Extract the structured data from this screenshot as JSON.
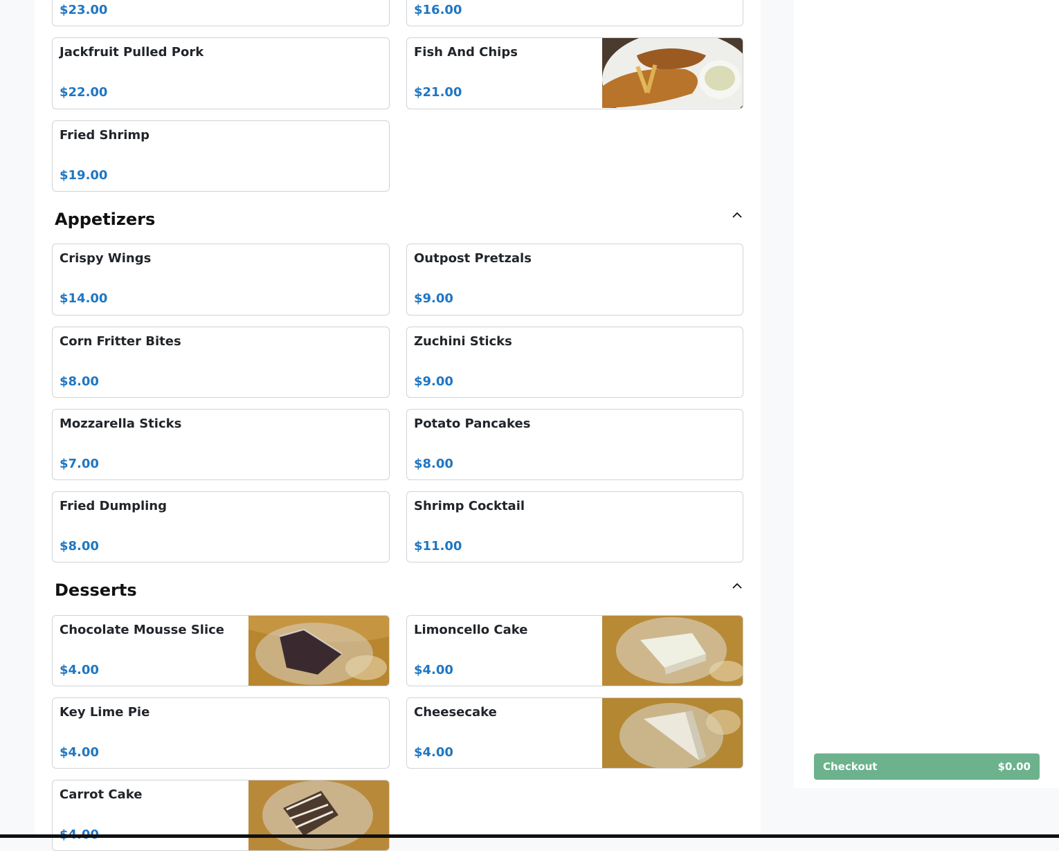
{
  "top_prices": {
    "left": "$23.00",
    "right": "$16.00"
  },
  "entrees_items": [
    {
      "name": "Jackfruit Pulled Pork",
      "price": "$22.00"
    },
    {
      "name": "Fish And Chips",
      "price": "$21.00",
      "image": "fish-and-chips-photo"
    },
    {
      "name": "Fried Shrimp",
      "price": "$19.00"
    }
  ],
  "appetizers": {
    "title": "Appetizers",
    "items": [
      {
        "name": "Crispy Wings",
        "price": "$14.00"
      },
      {
        "name": "Outpost Pretzals",
        "price": "$9.00"
      },
      {
        "name": "Corn Fritter Bites",
        "price": "$8.00"
      },
      {
        "name": "Zuchini Sticks",
        "price": "$9.00"
      },
      {
        "name": "Mozzarella Sticks",
        "price": "$7.00"
      },
      {
        "name": "Potato Pancakes",
        "price": "$8.00"
      },
      {
        "name": "Fried Dumpling",
        "price": "$8.00"
      },
      {
        "name": "Shrimp Cocktail",
        "price": "$11.00"
      }
    ]
  },
  "desserts": {
    "title": "Desserts",
    "items": [
      {
        "name": "Chocolate Mousse Slice",
        "price": "$4.00",
        "image": "chocolate-mousse-photo"
      },
      {
        "name": "Limoncello Cake",
        "price": "$4.00",
        "image": "limoncello-cake-photo"
      },
      {
        "name": "Key Lime Pie",
        "price": "$4.00"
      },
      {
        "name": "Cheesecake",
        "price": "$4.00",
        "image": "cheesecake-photo"
      },
      {
        "name": "Carrot Cake",
        "price": "$4.00",
        "image": "carrot-cake-photo"
      }
    ]
  },
  "section_icon": "chevron-up-icon",
  "checkout": {
    "label": "Checkout",
    "total": "$0.00"
  },
  "colors": {
    "price": "#1f76c2",
    "checkout": "#6cb28d",
    "background": "#f8f9fa"
  }
}
